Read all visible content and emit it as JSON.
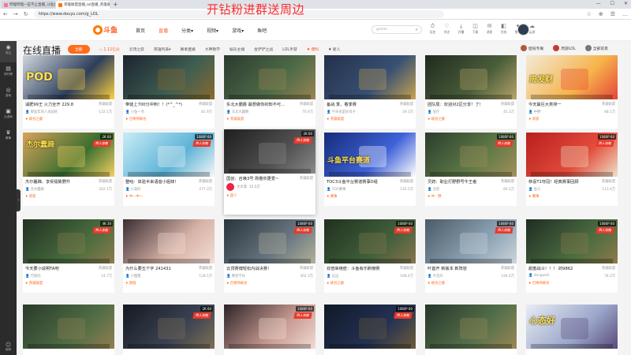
{
  "browser": {
    "tabs": [
      {
        "title": "哔哩哔哩一些不止直播_斗鱼直播",
        "active": false,
        "color": "#fb7299"
      },
      {
        "title": "英雄联盟直播_lol直播_英雄联盟",
        "active": true,
        "color": "#ff7700"
      }
    ],
    "new_tab": "+",
    "window_controls": [
      "—",
      "☐",
      "✕"
    ],
    "url": "https://www.douyu.com/g_LOL",
    "nav": [
      "←",
      "→",
      "↻"
    ],
    "addr_icons": [
      "☆",
      "⊕",
      "☰",
      "…"
    ]
  },
  "overlay_banner": "开钻粉进群送周边",
  "site": {
    "logo_text": "斗鱼",
    "nav": [
      {
        "label": "首页",
        "active": false
      },
      {
        "label": "直播",
        "active": true
      },
      {
        "label": "分类▾",
        "active": false
      },
      {
        "label": "视频▾",
        "active": false
      },
      {
        "label": "游戏▾",
        "active": false
      },
      {
        "label": "鱼吧",
        "active": false
      }
    ],
    "search_placeholder": "golem",
    "header_icons": [
      {
        "glyph": "⏱",
        "label": "历史"
      },
      {
        "glyph": "♡",
        "label": "关注"
      },
      {
        "glyph": "⤓",
        "label": "开播"
      },
      {
        "glyph": "◫",
        "label": "下载"
      },
      {
        "glyph": "✉",
        "label": "消息"
      },
      {
        "glyph": "◧",
        "label": "任务"
      },
      {
        "glyph": "✦",
        "label": "鱼吧"
      },
      {
        "glyph": "☁",
        "label": "云游"
      }
    ]
  },
  "rail": {
    "items": [
      {
        "glyph": "◉",
        "label": "关注"
      },
      {
        "glyph": "▤",
        "label": "排行榜"
      },
      {
        "glyph": "◎",
        "label": "游戏"
      },
      {
        "glyph": "▣",
        "label": "云游戏"
      },
      {
        "glyph": "♛",
        "label": "赛事"
      }
    ],
    "bottom": {
      "glyph": "☺",
      "label": "客服"
    },
    "toggle": "‹"
  },
  "page": {
    "title": "在线直播",
    "filters": [
      {
        "label": "全部",
        "type": "all"
      },
      {
        "label": "♨ 1.12亿分",
        "type": "hl"
      },
      {
        "label": "云顶之弈",
        "type": "plain"
      },
      {
        "label": "英雄列表▾",
        "type": "plain"
      },
      {
        "label": "赛事直播",
        "type": "plain"
      },
      {
        "label": "大神教学",
        "type": "plain"
      },
      {
        "label": "娱乐主播",
        "type": "plain"
      },
      {
        "label": "金铲铲之战",
        "type": "plain"
      },
      {
        "label": "LOL手游",
        "type": "plain"
      },
      {
        "label": "♦ 爆料",
        "type": "hl"
      },
      {
        "label": "♦ 新人",
        "type": "plain"
      }
    ],
    "pills": [
      {
        "label": "壁纸专属",
        "color": "#b05a3a"
      },
      {
        "label": "周游LOL",
        "color": "#c23c2f"
      },
      {
        "label": "全部前景",
        "color": "#777777"
      }
    ]
  },
  "cards": [
    {
      "title": "减肥99王 火力全开 229.8",
      "cat": "英雄联盟",
      "anchor": "那些年的人海战的",
      "views": "132.1万",
      "tag": "峡谷之巅",
      "bg1": "#cfd5dc",
      "bg2": "#2d3e5a",
      "bg3": "#ffd23f",
      "text": "POD",
      "text_top": 20,
      "text_size": 14
    },
    {
      "title": "带徒上700分冲刺！！(*^_^*)",
      "cat": "英雄联盟",
      "anchor": "小鱼一点",
      "views": "81.9万",
      "tag": "召唤师峡谷",
      "bg1": "#1c2430",
      "bg2": "#3f5e52",
      "bg3": "#8a6a2f",
      "text": "",
      "text_top": 0,
      "text_size": 0
    },
    {
      "title": "东北大霸爵 最想做你的知不可...",
      "cat": "英雄联盟",
      "anchor": "东北大霸爵",
      "views": "70.9万",
      "tag": "英雄联盟",
      "bg1": "#2b3a2f",
      "bg2": "#4e6b48",
      "bg3": "#9a8450",
      "text": "",
      "text_top": 0,
      "text_size": 0
    },
    {
      "title": "备战 季、看季赛",
      "cat": "英雄联盟",
      "anchor": "今天也是好日子",
      "views": "29.3万",
      "tag": "英雄联盟",
      "bg1": "#24304a",
      "bg2": "#385074",
      "bg3": "#c6a450",
      "text": "",
      "text_top": 0,
      "text_size": 0
    },
    {
      "title": "团队局：欢迎对2区分享！了！",
      "cat": "英雄联盟",
      "anchor": "旺仔",
      "views": "45.3万",
      "tag": "峡谷之巅",
      "bg1": "#1f2a1f",
      "bg2": "#4a5e3a",
      "bg3": "#b7a36b",
      "text": "",
      "text_top": 0,
      "text_size": 0
    },
    {
      "title": "今天最巨大类排一",
      "cat": "英雄联盟",
      "anchor": "中野",
      "views": "48.1万",
      "tag": "刺客",
      "bg1": "#f2ead7",
      "bg2": "#f6b44b",
      "bg3": "#e7443a",
      "text": "周发财",
      "text_top": 22,
      "text_size": 10
    },
    {
      "title": "杰尔蠢蹄、享受极致野升",
      "cat": "英雄联盟",
      "anchor": "杰尔蠢蹄",
      "views": "242.1万",
      "tag": "刺客",
      "bg1": "#d8a35a",
      "bg2": "#3a6e2f",
      "bg3": "#f4d061",
      "text": "杰尔蠢蹄",
      "text_top": 8,
      "text_size": 9
    },
    {
      "title": "整哈：体验半来语音小姐妹！",
      "cat": "英雄联盟",
      "anchor": "小美好",
      "views": "277.3万",
      "tag": "中一中一",
      "bg1": "#c8ecf7",
      "bg2": "#5cb3d6",
      "bg3": "#f7f7f7",
      "text": "",
      "text_top": 0,
      "text_size": 0
    },
    {
      "title": "国创：召唤3号 刚看你更爱~",
      "cat": "英雄联盟",
      "anchor": "大大哥",
      "views": "15.5万",
      "tag": "超人",
      "bg1": "#1e1e1e",
      "bg2": "#505050",
      "bg3": "#8a8a8a",
      "text": "",
      "text_top": 0,
      "text_size": 0,
      "pop": true
    },
    {
      "title": "TOC3斗鱼平台赛道赛事D组",
      "cat": "英雄联盟",
      "anchor": "TOC赛事",
      "views": "125.5万",
      "tag": "赛事",
      "bg1": "#162d7a",
      "bg2": "#3f62d8",
      "bg3": "#ffffff",
      "text": "斗鱼平台赛道",
      "text_top": 28,
      "text_size": 9
    },
    {
      "title": "灵药：职业打野野号牛王者",
      "cat": "英雄联盟",
      "anchor": "灵药",
      "views": "66.5万",
      "tag": "中 · 野",
      "bg1": "#2a3d2c",
      "bg2": "#5f7a48",
      "bg3": "#a38f5a",
      "text": "",
      "text_top": 0,
      "text_size": 0
    },
    {
      "title": "恭喜T1夺冠！经典赛事回顾",
      "cat": "英雄联盟",
      "anchor": "鱼三",
      "views": "113.4万",
      "tag": "赛事",
      "bg1": "#b81f1f",
      "bg2": "#e24c3b",
      "bg3": "#efe1c9",
      "text": "",
      "text_top": 0,
      "text_size": 0
    },
    {
      "title": "今天要小说明TA吧",
      "cat": "英雄联盟",
      "anchor": "可爱的",
      "views": "14.7万",
      "tag": "英雄联盟",
      "bg1": "#233023",
      "bg2": "#466b3d",
      "bg3": "#8d7c4d",
      "text": "",
      "text_top": 0,
      "text_size": 0
    },
    {
      "title": "为什么要五个字 241431",
      "cat": "英雄联盟",
      "anchor": "小甜甜",
      "views": "128.5万",
      "tag": "颜值",
      "bg1": "#3a2d32",
      "bg2": "#d6b2a6",
      "bg3": "#f4ded5",
      "text": "",
      "text_top": 0,
      "text_size": 0
    },
    {
      "title": "云顶赛博轻松内战决赛！",
      "cat": "英雄联盟",
      "anchor": "哪里不好",
      "views": "302.3万",
      "tag": "召唤师峡谷",
      "bg1": "#29343b",
      "bg2": "#677580",
      "bg3": "#b3b09a",
      "text": "",
      "text_top": 0,
      "text_size": 0
    },
    {
      "title": "双倍来绝密：斗鱼有乐刷榜赛",
      "cat": "英雄联盟",
      "anchor": "远远",
      "views": "168.4万",
      "tag": "峡谷之巅",
      "bg1": "#20301f",
      "bg2": "#3f5f3a",
      "bg3": "#867550",
      "text": "",
      "text_top": 0,
      "text_size": 0
    },
    {
      "title": "叶首开 新版本 新阵容",
      "cat": "英雄联盟",
      "anchor": "叶首开",
      "views": "194.4万",
      "tag": "峡谷之巅",
      "bg1": "#4b5a66",
      "bg2": "#8ca2b3",
      "bg3": "#cbd5dc",
      "text": "",
      "text_top": 0,
      "text_size": 0
    },
    {
      "title": "甜蜜战斗！！！ 的9862",
      "cat": "英雄联盟",
      "anchor": "dongwell",
      "views": "78.2万",
      "tag": "召唤师峡谷",
      "bg1": "#1f2d22",
      "bg2": "#4a6b40",
      "bg3": "#8c7a4a",
      "text": "",
      "text_top": 0,
      "text_size": 0
    },
    {
      "title": "",
      "cat": "",
      "anchor": "",
      "views": "",
      "tag": "",
      "bg1": "#2a3a2a",
      "bg2": "#4f6c45",
      "bg3": "#927f51",
      "text": "",
      "text_top": 0,
      "text_size": 0
    },
    {
      "title": "",
      "cat": "",
      "anchor": "",
      "views": "",
      "tag": "",
      "bg1": "#151a22",
      "bg2": "#3a4252",
      "bg3": "#7e6f56",
      "text": "",
      "text_top": 0,
      "text_size": 0
    },
    {
      "title": "",
      "cat": "",
      "anchor": "",
      "views": "",
      "tag": "",
      "bg1": "#2d2326",
      "bg2": "#c79a92",
      "bg3": "#f2dcd3",
      "text": "",
      "text_top": 0,
      "text_size": 0
    },
    {
      "title": "",
      "cat": "",
      "anchor": "",
      "views": "",
      "tag": "",
      "bg1": "#111827",
      "bg2": "#233152",
      "bg3": "#6d5b3a",
      "text": "",
      "text_top": 0,
      "text_size": 0
    },
    {
      "title": "",
      "cat": "",
      "anchor": "",
      "views": "",
      "tag": "",
      "bg1": "#26352a",
      "bg2": "#54704a",
      "bg3": "#9b8656",
      "text": "",
      "text_top": 0,
      "text_size": 0
    },
    {
      "title": "",
      "cat": "",
      "anchor": "",
      "views": "",
      "tag": "",
      "bg1": "#e9ecf5",
      "bg2": "#9aa6c9",
      "bg3": "#5a4a7a",
      "text": "心态好",
      "text_top": 12,
      "text_size": 11
    }
  ],
  "card_badges": [
    "",
    "",
    "",
    "",
    "",
    "",
    "2K 60",
    "1080P 60",
    "2K 60",
    "",
    "1080P 60",
    "1080P 60",
    "4K 30",
    "",
    "1080P 60",
    "1080P 60",
    "1080P 60",
    "1080P 60",
    "",
    "2K 60",
    "1080P 60",
    "1080P 60",
    "",
    ""
  ],
  "card_ribbon": "西人佳龍"
}
